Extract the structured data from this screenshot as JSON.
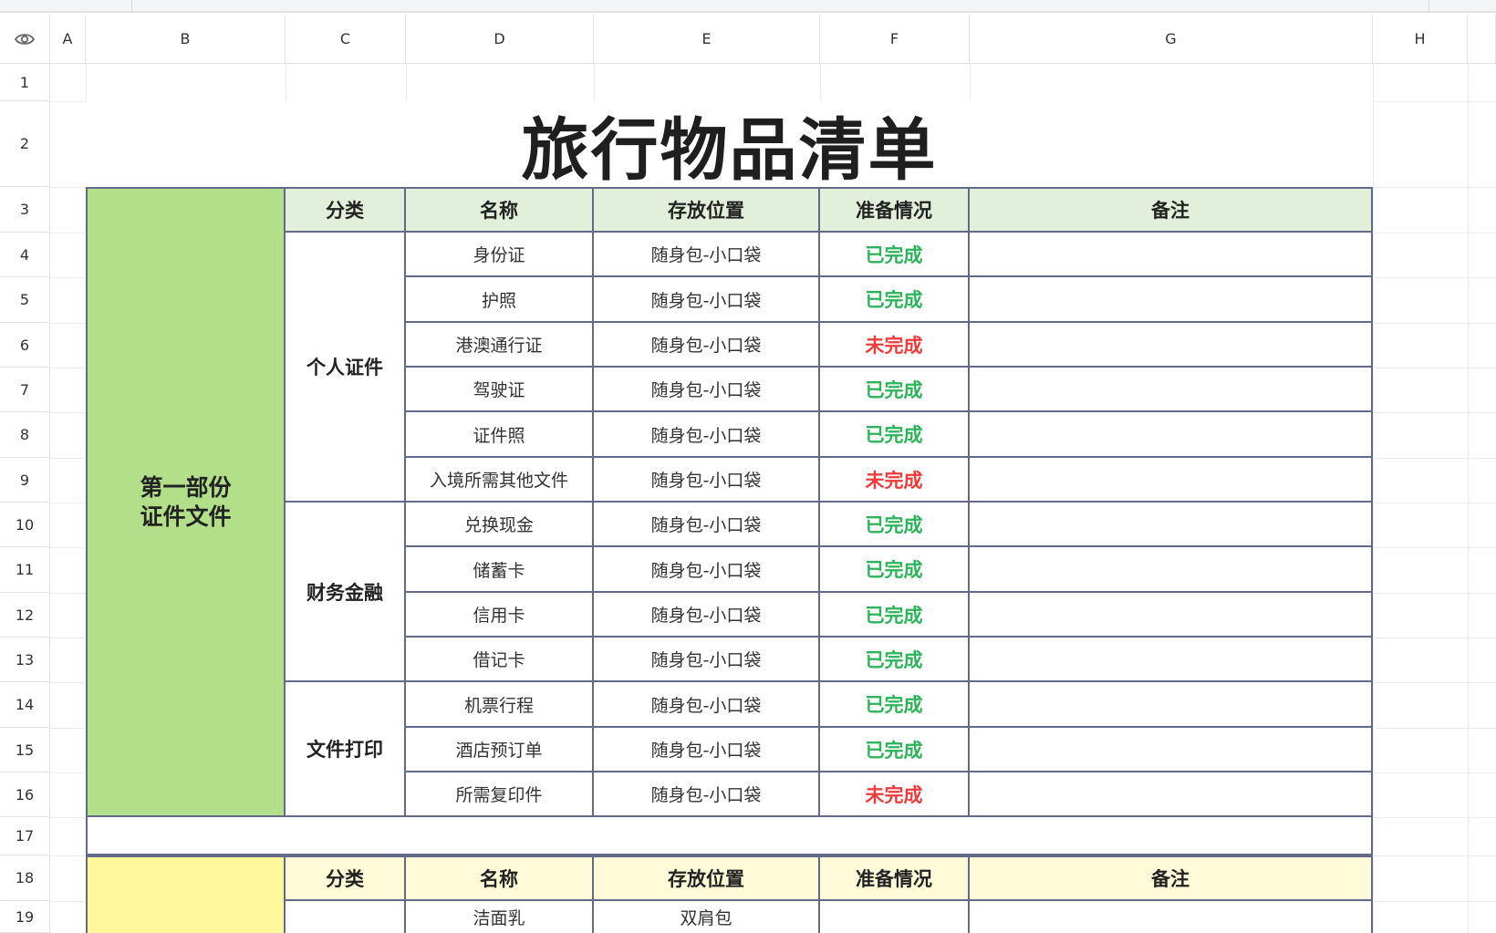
{
  "columns": [
    "A",
    "B",
    "C",
    "D",
    "E",
    "F",
    "G",
    "H"
  ],
  "rows": [
    "1",
    "2",
    "3",
    "4",
    "5",
    "6",
    "7",
    "8",
    "9",
    "10",
    "11",
    "12",
    "13",
    "14",
    "15",
    "16",
    "17",
    "18",
    "19"
  ],
  "title": "旅行物品清单",
  "headers": {
    "category": "分类",
    "name": "名称",
    "location": "存放位置",
    "status": "准备情况",
    "note": "备注"
  },
  "section1": {
    "label_line1": "第一部份",
    "label_line2": "证件文件",
    "groups": [
      {
        "category": "个人证件",
        "items": [
          {
            "name": "身份证",
            "location": "随身包-小口袋",
            "status": "已完成",
            "done": true
          },
          {
            "name": "护照",
            "location": "随身包-小口袋",
            "status": "已完成",
            "done": true
          },
          {
            "name": "港澳通行证",
            "location": "随身包-小口袋",
            "status": "未完成",
            "done": false
          },
          {
            "name": "驾驶证",
            "location": "随身包-小口袋",
            "status": "已完成",
            "done": true
          },
          {
            "name": "证件照",
            "location": "随身包-小口袋",
            "status": "已完成",
            "done": true
          },
          {
            "name": "入境所需其他文件",
            "location": "随身包-小口袋",
            "status": "未完成",
            "done": false
          }
        ]
      },
      {
        "category": "财务金融",
        "items": [
          {
            "name": "兑换现金",
            "location": "随身包-小口袋",
            "status": "已完成",
            "done": true
          },
          {
            "name": "储蓄卡",
            "location": "随身包-小口袋",
            "status": "已完成",
            "done": true
          },
          {
            "name": "信用卡",
            "location": "随身包-小口袋",
            "status": "已完成",
            "done": true
          },
          {
            "name": "借记卡",
            "location": "随身包-小口袋",
            "status": "已完成",
            "done": true
          }
        ]
      },
      {
        "category": "文件打印",
        "items": [
          {
            "name": "机票行程",
            "location": "随身包-小口袋",
            "status": "已完成",
            "done": true
          },
          {
            "name": "酒店预订单",
            "location": "随身包-小口袋",
            "status": "已完成",
            "done": true
          },
          {
            "name": "所需复印件",
            "location": "随身包-小口袋",
            "status": "未完成",
            "done": false
          }
        ]
      }
    ]
  },
  "section2": {
    "items": [
      {
        "name": "洁面乳",
        "location": "双肩包",
        "status": ""
      }
    ]
  },
  "colors": {
    "done": "#2db45a",
    "undone": "#ee3b3b",
    "section1_bg": "#b3de8a",
    "section1_header_bg": "#e2efda",
    "section2_bg": "#fff79b",
    "section2_header_bg": "#fffbd9"
  }
}
